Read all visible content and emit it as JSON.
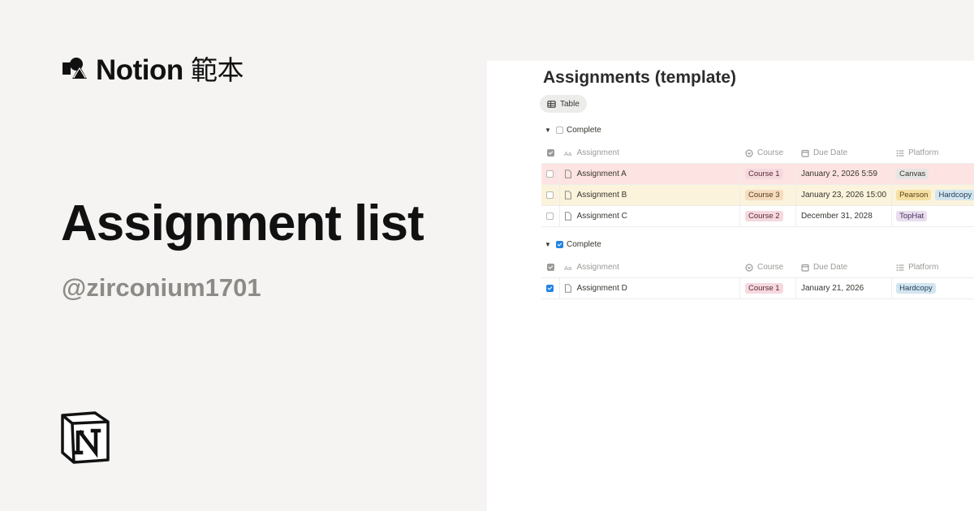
{
  "brand": {
    "name": "Notion",
    "suffix": "範本"
  },
  "title": "Assignment list",
  "handle": "@zirconium1701",
  "database": {
    "title": "Assignments (template)",
    "view_tab": "Table",
    "columns": {
      "name": "Assignment",
      "course": "Course",
      "due": "Due Date",
      "platform": "Platform"
    },
    "groups": [
      {
        "label": "Complete",
        "checked": false,
        "rows": [
          {
            "name": "Assignment A",
            "course": "Course 1",
            "due": "January 2, 2026 5:59",
            "platforms": [
              "Canvas"
            ],
            "checked": false
          },
          {
            "name": "Assignment B",
            "course": "Course 3",
            "due": "January 23, 2026 15:00",
            "platforms": [
              "Pearson",
              "Hardcopy"
            ],
            "checked": false
          },
          {
            "name": "Assignment C",
            "course": "Course 2",
            "due": "December 31, 2028",
            "platforms": [
              "TopHat"
            ],
            "checked": false
          }
        ]
      },
      {
        "label": "Complete",
        "checked": true,
        "rows": [
          {
            "name": "Assignment D",
            "course": "Course 1",
            "due": "January 21, 2026",
            "platforms": [
              "Hardcopy"
            ],
            "checked": true
          }
        ]
      }
    ]
  },
  "colors": {
    "background": "#f5f4f2",
    "row_overdue": "#fde4e2",
    "row_upcoming": "#fbf3db",
    "checkbox_checked": "#2383e2",
    "tag_course_1": "#f5d9df",
    "tag_course_2": "#f5d9df",
    "tag_course_3": "#f5dcc0",
    "tag_canvas": "#e6e5e3",
    "tag_pearson": "#f7e0a3",
    "tag_hardcopy": "#d3e5ef",
    "tag_tophat": "#e8deee"
  },
  "icons": {
    "brand_logo": "shapes-logo-icon",
    "notion_mark": "notion-logo-icon",
    "table_view": "table-icon",
    "title_property": "text-aa-icon",
    "course_property": "select-icon",
    "date_property": "calendar-icon",
    "platform_property": "multi-select-list-icon",
    "page": "page-icon"
  }
}
